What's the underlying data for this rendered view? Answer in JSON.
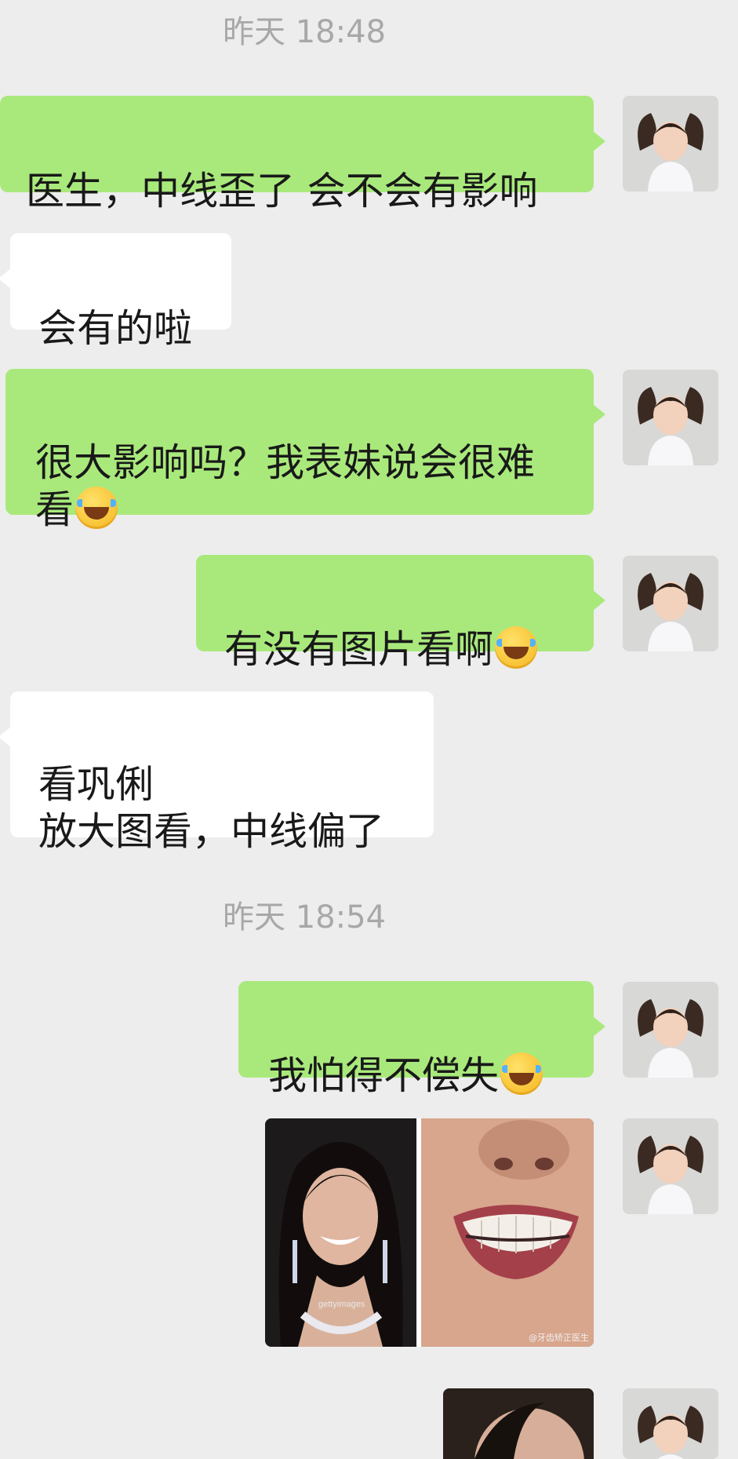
{
  "timestamps": [
    "昨天 18:48",
    "昨天 18:54"
  ],
  "messages": [
    {
      "side": "out",
      "text": "医生，中线歪了 会不会有影响"
    },
    {
      "side": "in",
      "text": "会有的啦"
    },
    {
      "side": "out",
      "text": "很大影响吗？我表妹说会很难\n看",
      "emoji": "tears-of-joy-emoji"
    },
    {
      "side": "out",
      "text": "有没有图片看啊",
      "emoji": "tears-of-joy-emoji"
    },
    {
      "side": "in",
      "text": "看巩俐\n放大图看，中线偏了"
    },
    {
      "side": "out",
      "text": "我怕得不偿失",
      "emoji": "tears-of-joy-emoji"
    },
    {
      "side": "out",
      "type": "image",
      "content": "celebrity smile photo beside close-up of teeth",
      "caption_left": "gettyimages",
      "caption_right": "@牙齿矫正医生"
    },
    {
      "side": "out",
      "type": "image",
      "content": "partially visible photo"
    }
  ],
  "colors": {
    "background": "#ededed",
    "outgoing_bubble": "#a9e97c",
    "incoming_bubble": "#ffffff",
    "timestamp_text": "#a8a8a8"
  }
}
